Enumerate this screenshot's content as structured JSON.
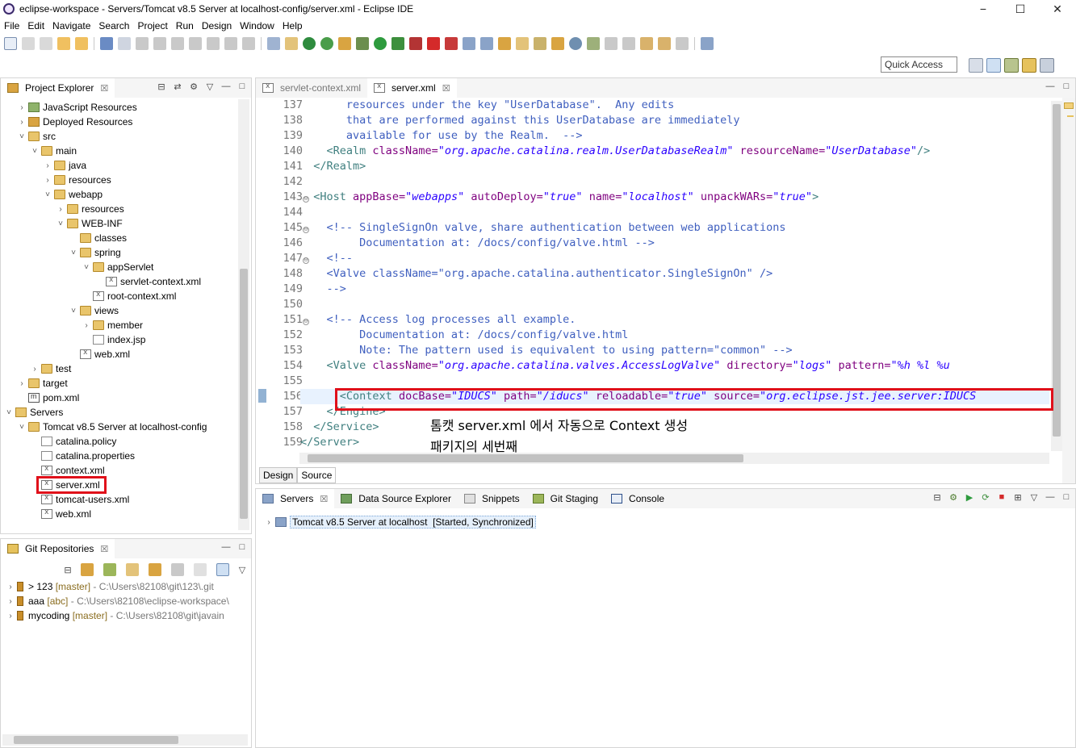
{
  "window": {
    "title": "eclipse-workspace - Servers/Tomcat v8.5 Server at localhost-config/server.xml - Eclipse IDE",
    "minimize": "−",
    "maximize": "☐",
    "close": "✕"
  },
  "menu": [
    "File",
    "Edit",
    "Navigate",
    "Search",
    "Project",
    "Run",
    "Design",
    "Window",
    "Help"
  ],
  "quick_access": "Quick Access",
  "project_explorer": {
    "title": "Project Explorer",
    "close": "☒",
    "tree": [
      {
        "label": "JavaScript Resources",
        "icon": "javascript-resources-icon",
        "twisty": ">",
        "indent": 0
      },
      {
        "label": "Deployed Resources",
        "icon": "deployed-resources-icon",
        "twisty": ">",
        "indent": 0
      },
      {
        "label": "src",
        "icon": "folder-icon",
        "twisty": "v",
        "indent": 0
      },
      {
        "label": "main",
        "icon": "folder-icon",
        "twisty": "v",
        "indent": 1
      },
      {
        "label": "java",
        "icon": "folder-icon",
        "twisty": ">",
        "indent": 2
      },
      {
        "label": "resources",
        "icon": "folder-icon",
        "twisty": ">",
        "indent": 2
      },
      {
        "label": "webapp",
        "icon": "folder-icon",
        "twisty": "v",
        "indent": 2
      },
      {
        "label": "resources",
        "icon": "folder-icon",
        "twisty": ">",
        "indent": 3
      },
      {
        "label": "WEB-INF",
        "icon": "folder-icon",
        "twisty": "v",
        "indent": 3
      },
      {
        "label": "classes",
        "icon": "folder-icon",
        "twisty": "",
        "indent": 4
      },
      {
        "label": "spring",
        "icon": "folder-icon",
        "twisty": "v",
        "indent": 4
      },
      {
        "label": "appServlet",
        "icon": "folder-icon",
        "twisty": "v",
        "indent": 5
      },
      {
        "label": "servlet-context.xml",
        "icon": "xml-file-icon",
        "twisty": "",
        "indent": 6
      },
      {
        "label": "root-context.xml",
        "icon": "xml-file-icon",
        "twisty": "",
        "indent": 5
      },
      {
        "label": "views",
        "icon": "folder-icon",
        "twisty": "v",
        "indent": 4
      },
      {
        "label": "member",
        "icon": "folder-icon",
        "twisty": ">",
        "indent": 5
      },
      {
        "label": "index.jsp",
        "icon": "jsp-file-icon",
        "twisty": "",
        "indent": 5
      },
      {
        "label": "web.xml",
        "icon": "xml-file-icon",
        "twisty": "",
        "indent": 4
      },
      {
        "label": "test",
        "icon": "folder-icon",
        "twisty": ">",
        "indent": 1
      },
      {
        "label": "target",
        "icon": "folder-icon",
        "twisty": ">",
        "indent": 0
      },
      {
        "label": "pom.xml",
        "icon": "maven-pom-icon",
        "twisty": "",
        "indent": 0
      },
      {
        "label": "Servers",
        "icon": "servers-folder-icon",
        "twisty": "v",
        "indent": -1
      },
      {
        "label": "Tomcat v8.5 Server at localhost-config",
        "icon": "folder-icon",
        "twisty": "v",
        "indent": 0
      },
      {
        "label": "catalina.policy",
        "icon": "text-file-icon",
        "twisty": "",
        "indent": 1
      },
      {
        "label": "catalina.properties",
        "icon": "text-file-icon",
        "twisty": "",
        "indent": 1
      },
      {
        "label": "context.xml",
        "icon": "xml-file-icon",
        "twisty": "",
        "indent": 1
      },
      {
        "label": "server.xml",
        "icon": "xml-file-icon",
        "twisty": "",
        "indent": 1
      },
      {
        "label": "tomcat-users.xml",
        "icon": "xml-file-icon",
        "twisty": "",
        "indent": 1
      },
      {
        "label": "web.xml",
        "icon": "xml-file-icon",
        "twisty": "",
        "indent": 1
      }
    ]
  },
  "git_repos": {
    "title": "Git Repositories",
    "close": "☒",
    "items": [
      {
        "prefix": "> 123",
        "branch": "[master]",
        "path": "- C:\\Users\\82108\\git\\123\\.git"
      },
      {
        "prefix": "aaa",
        "branch": "[abc]",
        "path": "- C:\\Users\\82108\\eclipse-workspace\\"
      },
      {
        "prefix": "mycoding",
        "branch": "[master]",
        "path": "- C:\\Users\\82108\\git\\javain"
      }
    ]
  },
  "editor": {
    "tabs": [
      {
        "label": "servlet-context.xml",
        "active": false
      },
      {
        "label": "server.xml",
        "active": true,
        "close": "☒"
      }
    ],
    "lines": [
      137,
      138,
      139,
      140,
      141,
      142,
      143,
      144,
      145,
      146,
      147,
      148,
      149,
      150,
      151,
      152,
      153,
      154,
      155,
      156,
      157,
      158,
      159
    ],
    "folds": [
      "⊖",
      "⊖",
      "⊖",
      "⊖"
    ],
    "code": {
      "l137": "       resources under the key \"UserDatabase\".  Any edits",
      "l138": "       that are performed against this UserDatabase are immediately",
      "l139": "       available for use by the Realm.  -->",
      "l140_indent": "    ",
      "l140_tag": "<Realm ",
      "l140_a1": "className=",
      "l140_v1": "\"org.apache.catalina.realm.UserDatabaseRealm\"",
      "l140_a2": " resourceName=",
      "l140_v2": "\"UserDatabase\"",
      "l140_end": "/>",
      "l141": "  </Realm>",
      "l143_indent": "  ",
      "l143_tag": "<Host ",
      "l143_a1": "appBase=",
      "l143_v1": "\"webapps\"",
      "l143_a2": " autoDeploy=",
      "l143_v2": "\"true\"",
      "l143_a3": " name=",
      "l143_v3": "\"localhost\"",
      "l143_a4": " unpackWARs=",
      "l143_v4": "\"true\"",
      "l143_end": ">",
      "l145": "    <!-- SingleSignOn valve, share authentication between web applications",
      "l146": "         Documentation at: /docs/config/valve.html -->",
      "l147": "    <!--",
      "l148": "    <Valve className=\"org.apache.catalina.authenticator.SingleSignOn\" />",
      "l149": "    -->",
      "l151": "    <!-- Access log processes all example.",
      "l152": "         Documentation at: /docs/config/valve.html",
      "l153": "         Note: The pattern used is equivalent to using pattern=\"common\" -->",
      "l154_indent": "    ",
      "l154_tag": "<Valve ",
      "l154_a1": "className=",
      "l154_v1": "\"org.apache.catalina.valves.AccessLogValve\"",
      "l154_a2": " directory=",
      "l154_v2": "\"logs\"",
      "l154_a3": " pattern=",
      "l154_v3": "\"%h %l %u",
      "l156_indent": "      ",
      "l156_tag": "<Context ",
      "l156_a1": "docBase=",
      "l156_v1": "\"IDUCS\"",
      "l156_a2": " path=",
      "l156_v2": "\"/iducs\"",
      "l156_a3": " reloadable=",
      "l156_v3": "\"true\"",
      "l156_a4": " source=",
      "l156_v4": "\"org.eclipse.jst.jee.server:IDUCS",
      "l157": "    </Engine>",
      "l158": "  </Service>",
      "l159": "</Server>"
    },
    "bottom_tabs": [
      "Design",
      "Source"
    ],
    "annotation_line1": "톰캣 server.xml 에서 자동으로 Context 생성",
    "annotation_line2": "패키지의 세번째"
  },
  "servers_view": {
    "tabs": [
      "Servers",
      "Data Source Explorer",
      "Snippets",
      "Git Staging",
      "Console"
    ],
    "close": "☒",
    "server_name": "Tomcat v8.5 Server at localhost",
    "server_status": "[Started, Synchronized]"
  },
  "colors": {
    "highlight_red": "#e0101a",
    "xml_tag": "#3f7f7f",
    "xml_attr": "#7f007f",
    "xml_value": "#2a00ff",
    "xml_comment": "#3f5fbf"
  }
}
